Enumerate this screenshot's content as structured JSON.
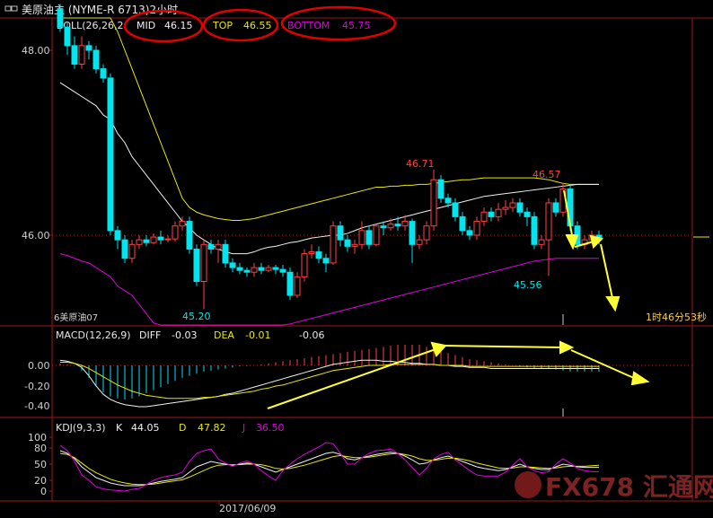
{
  "title": "美原油主 (NYME-R 6713)2小时",
  "window_icon": "window-icon",
  "boll": {
    "label": "BOLL(26,26,2",
    "mid_label": "MID",
    "mid_value": "46.15",
    "top_label": "TOP",
    "top_value": "46.55",
    "bottom_label": "BOTTOM",
    "bottom_value": "45.75"
  },
  "price_ticks": [
    "48.00",
    "46.00"
  ],
  "annotations": {
    "high1": "46.71",
    "high2": "46.57",
    "low1": "45.20",
    "low2": "45.56"
  },
  "symbol_label": "6美原油07",
  "countdown": "1时46分53秒",
  "macd": {
    "label": "MACD(12,26,9)",
    "diff_label": "DIFF",
    "diff_value": "-0.03",
    "dea_label": "DEA",
    "dea_value": "-0.01",
    "macd_value": "-0.06",
    "ticks": [
      "0.00",
      "-0.20",
      "-0.40"
    ]
  },
  "kdj": {
    "label": "KDJ(9,3,3)",
    "k_label": "K",
    "k_value": "44.05",
    "d_label": "D",
    "d_value": "47.82",
    "j_label": "J",
    "j_value": "36.50",
    "ticks": [
      "100",
      "80",
      "50",
      "20",
      "0"
    ]
  },
  "date_label": "2017/06/09",
  "watermark": "FX678 汇通网",
  "colors": {
    "up": "#ff4040",
    "down": "#00e5ee",
    "mid": "#f0f0f0",
    "band": "#e8e800",
    "bottom": "#e000e0",
    "annotation": "#ffff33",
    "circle": "#e00000"
  },
  "chart_data": [
    {
      "type": "candlestick",
      "title": "美原油主 (NYME-R 6713)2小时",
      "ylim": [
        44.85,
        48.45
      ],
      "y_ticks": [
        48.0,
        46.0
      ],
      "candles": [
        [
          48.45,
          48.25,
          48.5,
          48.2
        ],
        [
          48.25,
          48.05,
          48.3,
          47.95
        ],
        [
          48.05,
          47.85,
          48.15,
          47.8
        ],
        [
          47.85,
          48.05,
          48.15,
          47.8
        ],
        [
          48.05,
          48.0,
          48.1,
          47.9
        ],
        [
          48.0,
          47.8,
          48.05,
          47.75
        ],
        [
          47.8,
          47.7,
          47.85,
          47.65
        ],
        [
          47.7,
          46.05,
          47.75,
          46.0
        ],
        [
          46.05,
          45.95,
          46.1,
          45.85
        ],
        [
          45.95,
          45.75,
          46.0,
          45.7
        ],
        [
          45.75,
          45.9,
          45.95,
          45.7
        ],
        [
          45.9,
          45.95,
          46.0,
          45.85
        ],
        [
          45.95,
          45.92,
          46.0,
          45.88
        ],
        [
          45.92,
          45.98,
          46.02,
          45.9
        ],
        [
          45.98,
          45.95,
          46.05,
          45.9
        ],
        [
          45.95,
          45.96,
          46.0,
          45.92
        ],
        [
          45.96,
          46.1,
          46.15,
          45.93
        ],
        [
          46.1,
          46.15,
          46.2,
          46.05
        ],
        [
          46.15,
          45.85,
          46.2,
          45.8
        ],
        [
          45.85,
          45.5,
          45.9,
          45.45
        ],
        [
          45.5,
          45.9,
          45.95,
          45.2
        ],
        [
          45.9,
          45.85,
          45.95,
          45.8
        ],
        [
          45.85,
          45.9,
          45.95,
          45.7
        ],
        [
          45.9,
          45.7,
          45.95,
          45.65
        ],
        [
          45.7,
          45.65,
          45.75,
          45.6
        ],
        [
          45.65,
          45.62,
          45.7,
          45.58
        ],
        [
          45.62,
          45.6,
          45.65,
          45.55
        ],
        [
          45.6,
          45.65,
          45.7,
          45.55
        ],
        [
          45.65,
          45.62,
          45.7,
          45.58
        ],
        [
          45.62,
          45.65,
          45.68,
          45.6
        ],
        [
          45.65,
          45.63,
          45.68,
          45.58
        ],
        [
          45.63,
          45.6,
          45.68,
          45.55
        ],
        [
          45.6,
          45.35,
          45.65,
          45.3
        ],
        [
          45.35,
          45.55,
          45.6,
          45.32
        ],
        [
          45.55,
          45.8,
          45.85,
          45.5
        ],
        [
          45.8,
          45.82,
          45.9,
          45.75
        ],
        [
          45.82,
          45.75,
          45.88,
          45.7
        ],
        [
          45.75,
          45.7,
          45.8,
          45.6
        ],
        [
          45.7,
          46.1,
          46.15,
          45.68
        ],
        [
          46.1,
          45.95,
          46.15,
          45.88
        ],
        [
          45.95,
          45.88,
          46.0,
          45.82
        ],
        [
          45.88,
          45.9,
          45.95,
          45.8
        ],
        [
          45.9,
          46.05,
          46.15,
          45.85
        ],
        [
          46.05,
          45.9,
          46.1,
          45.85
        ],
        [
          45.9,
          46.1,
          46.12,
          45.88
        ],
        [
          46.1,
          46.08,
          46.15,
          46.0
        ],
        [
          46.08,
          46.12,
          46.18,
          46.05
        ],
        [
          46.12,
          46.1,
          46.2,
          46.05
        ],
        [
          46.1,
          46.15,
          46.22,
          46.05
        ],
        [
          46.15,
          45.9,
          46.18,
          45.7
        ],
        [
          45.9,
          45.95,
          46.0,
          45.85
        ],
        [
          45.95,
          46.1,
          46.15,
          45.9
        ],
        [
          46.1,
          46.6,
          46.71,
          46.05
        ],
        [
          46.6,
          46.4,
          46.65,
          46.35
        ],
        [
          46.4,
          46.35,
          46.45,
          46.3
        ],
        [
          46.35,
          46.2,
          46.4,
          46.15
        ],
        [
          46.2,
          46.05,
          46.25,
          46.0
        ],
        [
          46.05,
          46.0,
          46.1,
          45.95
        ],
        [
          46.0,
          46.15,
          46.2,
          45.95
        ],
        [
          46.15,
          46.25,
          46.3,
          46.1
        ],
        [
          46.25,
          46.2,
          46.3,
          46.15
        ],
        [
          46.2,
          46.28,
          46.35,
          46.15
        ],
        [
          46.28,
          46.3,
          46.38,
          46.22
        ],
        [
          46.3,
          46.35,
          46.4,
          46.25
        ],
        [
          46.35,
          46.25,
          46.4,
          46.2
        ],
        [
          46.25,
          46.2,
          46.3,
          46.1
        ],
        [
          46.2,
          45.9,
          46.25,
          45.85
        ],
        [
          45.9,
          45.95,
          46.0,
          45.85
        ],
        [
          45.95,
          46.35,
          46.4,
          45.56
        ],
        [
          46.35,
          46.25,
          46.4,
          46.2
        ],
        [
          46.25,
          46.5,
          46.57,
          46.2
        ],
        [
          46.5,
          46.1,
          46.55,
          46.05
        ],
        [
          46.1,
          45.9,
          46.15,
          45.85
        ],
        [
          45.9,
          45.95,
          46.0,
          45.85
        ],
        [
          45.95,
          46.0,
          46.05,
          45.92
        ],
        [
          46.0,
          45.95,
          46.05,
          45.9
        ]
      ],
      "mid": [
        47.65,
        47.6,
        47.55,
        47.5,
        47.45,
        47.4,
        47.3,
        47.25,
        47.1,
        47.0,
        46.85,
        46.75,
        46.65,
        46.55,
        46.45,
        46.35,
        46.25,
        46.15,
        46.08,
        46.0,
        45.95,
        45.9,
        45.85,
        45.82,
        45.8,
        45.8,
        45.8,
        45.82,
        45.85,
        45.87,
        45.88,
        45.9,
        45.92,
        45.93,
        45.95,
        45.97,
        45.98,
        45.99,
        46.0,
        46.0,
        46.02,
        46.05,
        46.08,
        46.1,
        46.12,
        46.14,
        46.16,
        46.18,
        46.2,
        46.22,
        46.24,
        46.26,
        46.28,
        46.3,
        46.32,
        46.34,
        46.36,
        46.38,
        46.4,
        46.42,
        46.43,
        46.44,
        46.45,
        46.46,
        46.47,
        46.48,
        46.49,
        46.5,
        46.51,
        46.52,
        46.53,
        46.54,
        46.55,
        46.55,
        46.55,
        46.55
      ],
      "top": [
        49.8,
        49.6,
        49.4,
        49.2,
        49.0,
        48.8,
        48.6,
        48.4,
        48.2,
        48.0,
        47.8,
        47.6,
        47.4,
        47.2,
        47.0,
        46.8,
        46.6,
        46.4,
        46.3,
        46.25,
        46.22,
        46.2,
        46.18,
        46.17,
        46.16,
        46.16,
        46.17,
        46.18,
        46.2,
        46.22,
        46.24,
        46.26,
        46.28,
        46.3,
        46.32,
        46.34,
        46.36,
        46.38,
        46.4,
        46.42,
        46.44,
        46.46,
        46.48,
        46.5,
        46.52,
        46.52,
        46.53,
        46.53,
        46.54,
        46.54,
        46.55,
        46.55,
        46.56,
        46.57,
        46.58,
        46.59,
        46.6,
        46.6,
        46.61,
        46.62,
        46.62,
        46.62,
        46.62,
        46.62,
        46.62,
        46.62,
        46.62,
        46.61,
        46.6,
        46.58,
        46.56,
        46.55,
        46.55,
        46.55,
        46.55,
        46.55
      ],
      "bottom": [
        45.8,
        45.78,
        45.75,
        45.72,
        45.7,
        45.65,
        45.6,
        45.55,
        45.45,
        45.4,
        45.35,
        45.25,
        45.15,
        45.05,
        45.0,
        44.95,
        44.92,
        44.9,
        44.9,
        44.9,
        44.9,
        44.9,
        44.9,
        44.91,
        44.92,
        44.93,
        44.94,
        44.95,
        44.96,
        44.98,
        45.0,
        45.02,
        45.04,
        45.06,
        45.08,
        45.1,
        45.12,
        45.14,
        45.16,
        45.18,
        45.2,
        45.22,
        45.24,
        45.26,
        45.28,
        45.3,
        45.32,
        45.34,
        45.36,
        45.38,
        45.4,
        45.42,
        45.44,
        45.46,
        45.48,
        45.5,
        45.52,
        45.54,
        45.56,
        45.58,
        45.6,
        45.62,
        45.64,
        45.66,
        45.68,
        45.7,
        45.72,
        45.73,
        45.74,
        45.75,
        45.75,
        45.75,
        45.75,
        45.75,
        45.75,
        45.75
      ]
    },
    {
      "type": "bar",
      "title": "MACD(12,26,9)",
      "ylim": [
        -0.5,
        0.2
      ],
      "y_ticks": [
        0.0,
        -0.2,
        -0.4
      ],
      "macd_hist": [
        0.02,
        0.01,
        0.0,
        -0.05,
        -0.12,
        -0.2,
        -0.26,
        -0.3,
        -0.32,
        -0.33,
        -0.32,
        -0.3,
        -0.27,
        -0.24,
        -0.21,
        -0.18,
        -0.15,
        -0.12,
        -0.1,
        -0.08,
        -0.06,
        -0.05,
        -0.04,
        -0.03,
        -0.02,
        -0.01,
        -0.005,
        0.0,
        0.01,
        0.02,
        0.03,
        0.04,
        0.05,
        0.06,
        0.07,
        0.08,
        0.09,
        0.1,
        0.11,
        0.12,
        0.13,
        0.14,
        0.15,
        0.16,
        0.17,
        0.18,
        0.19,
        0.2,
        0.2,
        0.2,
        0.2,
        0.18,
        0.16,
        0.14,
        0.12,
        0.1,
        0.08,
        0.06,
        0.05,
        0.04,
        0.03,
        0.02,
        0.01,
        0.0,
        -0.01,
        -0.02,
        -0.03,
        -0.03,
        -0.03,
        -0.04,
        -0.05,
        -0.06,
        -0.06,
        -0.06,
        -0.06,
        -0.06
      ],
      "diff": [
        0.05,
        0.04,
        0.02,
        -0.02,
        -0.1,
        -0.2,
        -0.28,
        -0.33,
        -0.36,
        -0.38,
        -0.39,
        -0.4,
        -0.4,
        -0.39,
        -0.38,
        -0.37,
        -0.36,
        -0.35,
        -0.34,
        -0.33,
        -0.32,
        -0.31,
        -0.3,
        -0.28,
        -0.27,
        -0.25,
        -0.23,
        -0.21,
        -0.19,
        -0.17,
        -0.15,
        -0.13,
        -0.11,
        -0.09,
        -0.07,
        -0.05,
        -0.03,
        -0.01,
        0.01,
        0.02,
        0.03,
        0.04,
        0.05,
        0.05,
        0.05,
        0.04,
        0.04,
        0.03,
        0.03,
        0.02,
        0.02,
        0.01,
        0.01,
        0.0,
        0.0,
        -0.01,
        -0.01,
        -0.02,
        -0.02,
        -0.02,
        -0.03,
        -0.03,
        -0.03,
        -0.03,
        -0.03,
        -0.03,
        -0.03,
        -0.03,
        -0.03,
        -0.03,
        -0.03,
        -0.03,
        -0.03,
        -0.03,
        -0.03,
        -0.03
      ],
      "dea": [
        0.03,
        0.03,
        0.02,
        0.0,
        -0.03,
        -0.07,
        -0.11,
        -0.15,
        -0.19,
        -0.22,
        -0.25,
        -0.27,
        -0.29,
        -0.3,
        -0.31,
        -0.32,
        -0.32,
        -0.32,
        -0.32,
        -0.32,
        -0.31,
        -0.31,
        -0.3,
        -0.29,
        -0.28,
        -0.27,
        -0.26,
        -0.25,
        -0.23,
        -0.22,
        -0.2,
        -0.19,
        -0.17,
        -0.15,
        -0.13,
        -0.11,
        -0.09,
        -0.07,
        -0.05,
        -0.04,
        -0.03,
        -0.02,
        -0.01,
        0.0,
        0.0,
        0.0,
        0.01,
        0.01,
        0.01,
        0.01,
        0.01,
        0.01,
        0.01,
        0.0,
        0.0,
        0.0,
        0.0,
        -0.01,
        -0.01,
        -0.01,
        -0.01,
        -0.01,
        -0.01,
        -0.01,
        -0.01,
        -0.01,
        -0.01,
        -0.01,
        -0.01,
        -0.01,
        -0.01,
        -0.01,
        -0.01,
        -0.01,
        -0.01,
        -0.01
      ]
    },
    {
      "type": "line",
      "title": "KDJ(9,3,3)",
      "ylim": [
        0,
        110
      ],
      "y_ticks": [
        100,
        80,
        50,
        20,
        0
      ],
      "series": [
        {
          "name": "K",
          "values": [
            75,
            70,
            60,
            45,
            35,
            25,
            20,
            15,
            12,
            10,
            10,
            10,
            12,
            15,
            18,
            20,
            22,
            25,
            35,
            45,
            50,
            55,
            52,
            50,
            48,
            50,
            52,
            50,
            45,
            40,
            35,
            40,
            45,
            50,
            55,
            60,
            65,
            70,
            72,
            68,
            60,
            58,
            62,
            65,
            68,
            70,
            72,
            70,
            65,
            58,
            50,
            52,
            58,
            62,
            65,
            60,
            55,
            50,
            45,
            42,
            40,
            38,
            40,
            45,
            50,
            45,
            42,
            40,
            40,
            45,
            50,
            48,
            45,
            44,
            44,
            44
          ]
        },
        {
          "name": "D",
          "values": [
            70,
            68,
            62,
            52,
            42,
            34,
            28,
            22,
            18,
            15,
            13,
            12,
            12,
            13,
            15,
            17,
            19,
            21,
            26,
            32,
            38,
            44,
            48,
            49,
            49,
            49,
            50,
            50,
            49,
            46,
            42,
            41,
            42,
            45,
            48,
            52,
            56,
            60,
            64,
            66,
            64,
            62,
            62,
            63,
            65,
            67,
            69,
            70,
            68,
            65,
            60,
            57,
            57,
            59,
            61,
            61,
            59,
            56,
            52,
            49,
            46,
            43,
            42,
            43,
            45,
            45,
            44,
            43,
            42,
            43,
            45,
            46,
            46,
            46,
            47,
            48
          ]
        },
        {
          "name": "J",
          "values": [
            85,
            75,
            55,
            30,
            20,
            8,
            4,
            2,
            1,
            0,
            3,
            5,
            12,
            20,
            25,
            28,
            30,
            35,
            55,
            70,
            75,
            78,
            60,
            52,
            46,
            52,
            56,
            50,
            38,
            28,
            20,
            38,
            50,
            60,
            68,
            75,
            82,
            90,
            88,
            70,
            50,
            50,
            62,
            70,
            75,
            76,
            78,
            70,
            58,
            44,
            30,
            42,
            60,
            68,
            72,
            58,
            48,
            38,
            30,
            28,
            28,
            28,
            35,
            48,
            60,
            45,
            38,
            34,
            36,
            50,
            60,
            52,
            42,
            38,
            36,
            36
          ]
        }
      ]
    }
  ]
}
